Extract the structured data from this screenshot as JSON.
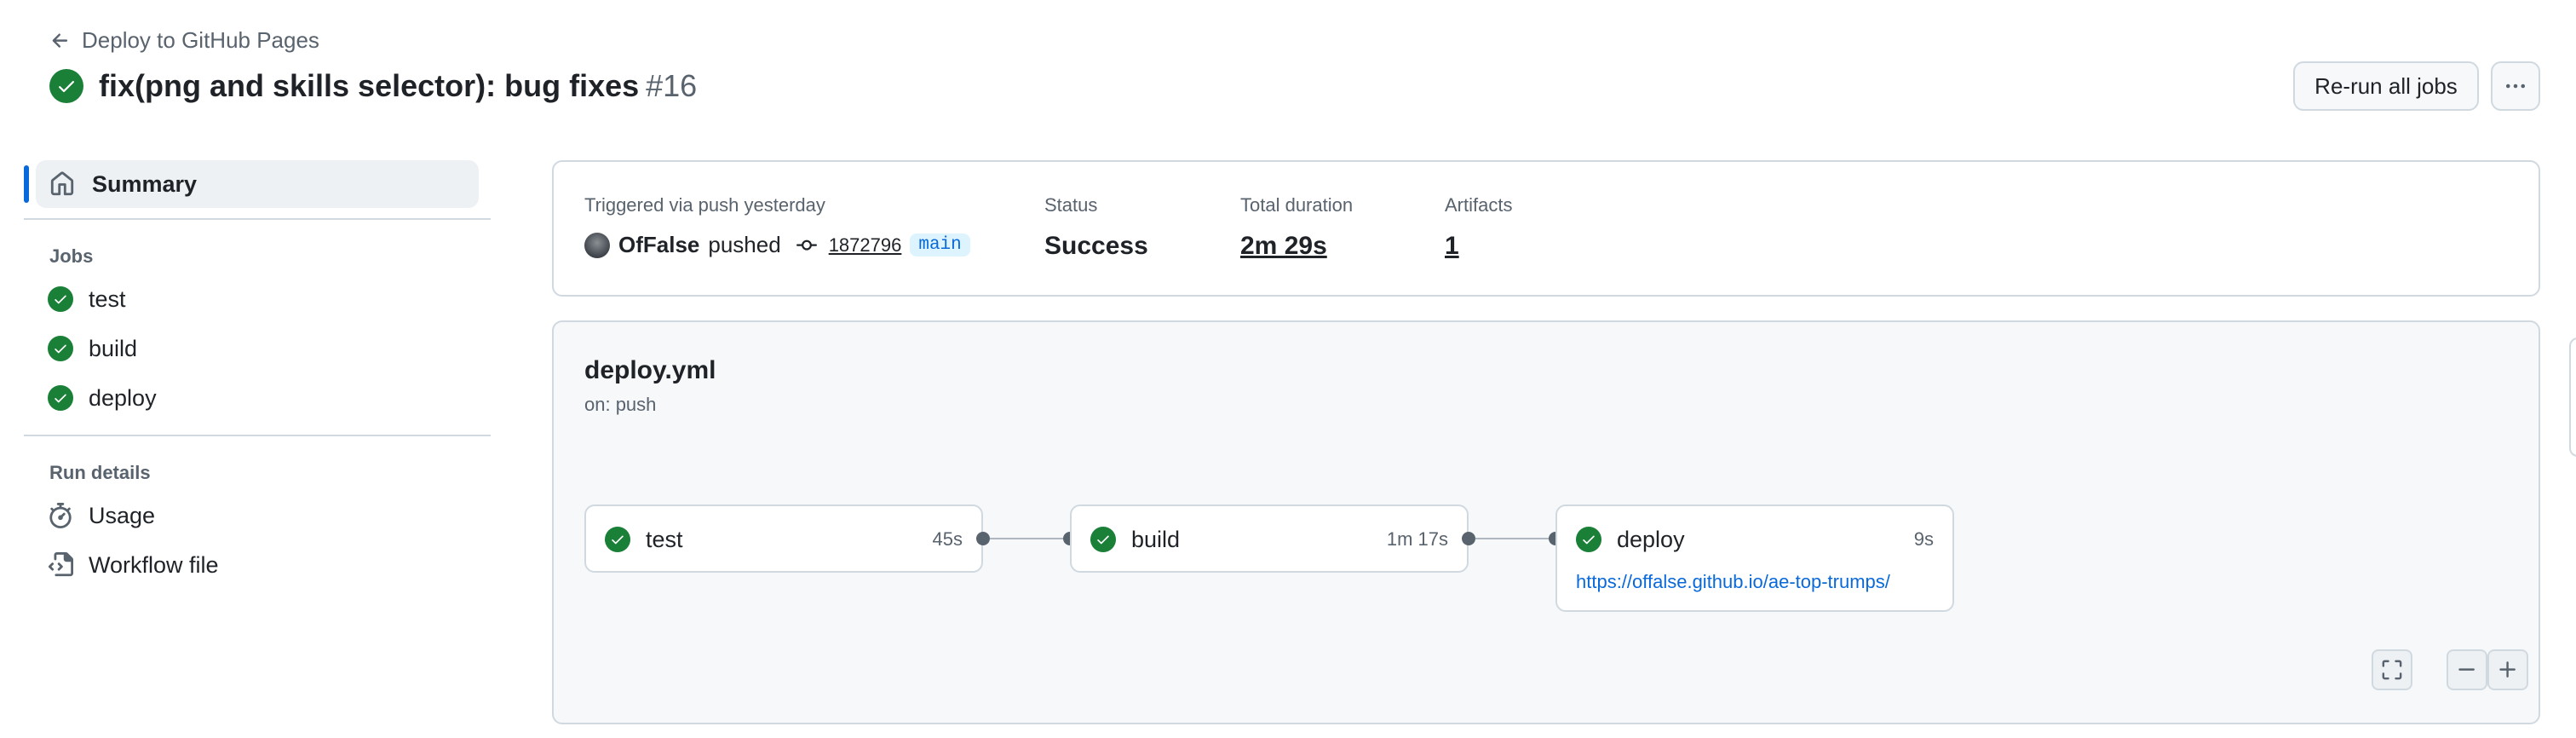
{
  "header": {
    "back_label": "Deploy to GitHub Pages",
    "title": "fix(png and skills selector): bug fixes",
    "run_number": "#16",
    "rerun_label": "Re-run all jobs"
  },
  "sidebar": {
    "summary_label": "Summary",
    "jobs_title": "Jobs",
    "jobs": [
      {
        "label": "test"
      },
      {
        "label": "build"
      },
      {
        "label": "deploy"
      }
    ],
    "run_details_title": "Run details",
    "details": [
      {
        "label": "Usage"
      },
      {
        "label": "Workflow file"
      }
    ]
  },
  "trigger": {
    "triggered_label": "Triggered via push yesterday",
    "user": "OfFalse",
    "action": "pushed",
    "commit": "1872796",
    "branch": "main",
    "status_label": "Status",
    "status_value": "Success",
    "duration_label": "Total duration",
    "duration_value": "2m 29s",
    "artifacts_label": "Artifacts",
    "artifacts_value": "1"
  },
  "workflow": {
    "file": "deploy.yml",
    "on": "on: push",
    "jobs": [
      {
        "name": "test",
        "duration": "45s"
      },
      {
        "name": "build",
        "duration": "1m 17s"
      },
      {
        "name": "deploy",
        "duration": "9s",
        "url": "https://offalse.github.io/ae-top-trumps/"
      }
    ]
  },
  "colors": {
    "success": "#1a7f37",
    "accent": "#0969da"
  }
}
